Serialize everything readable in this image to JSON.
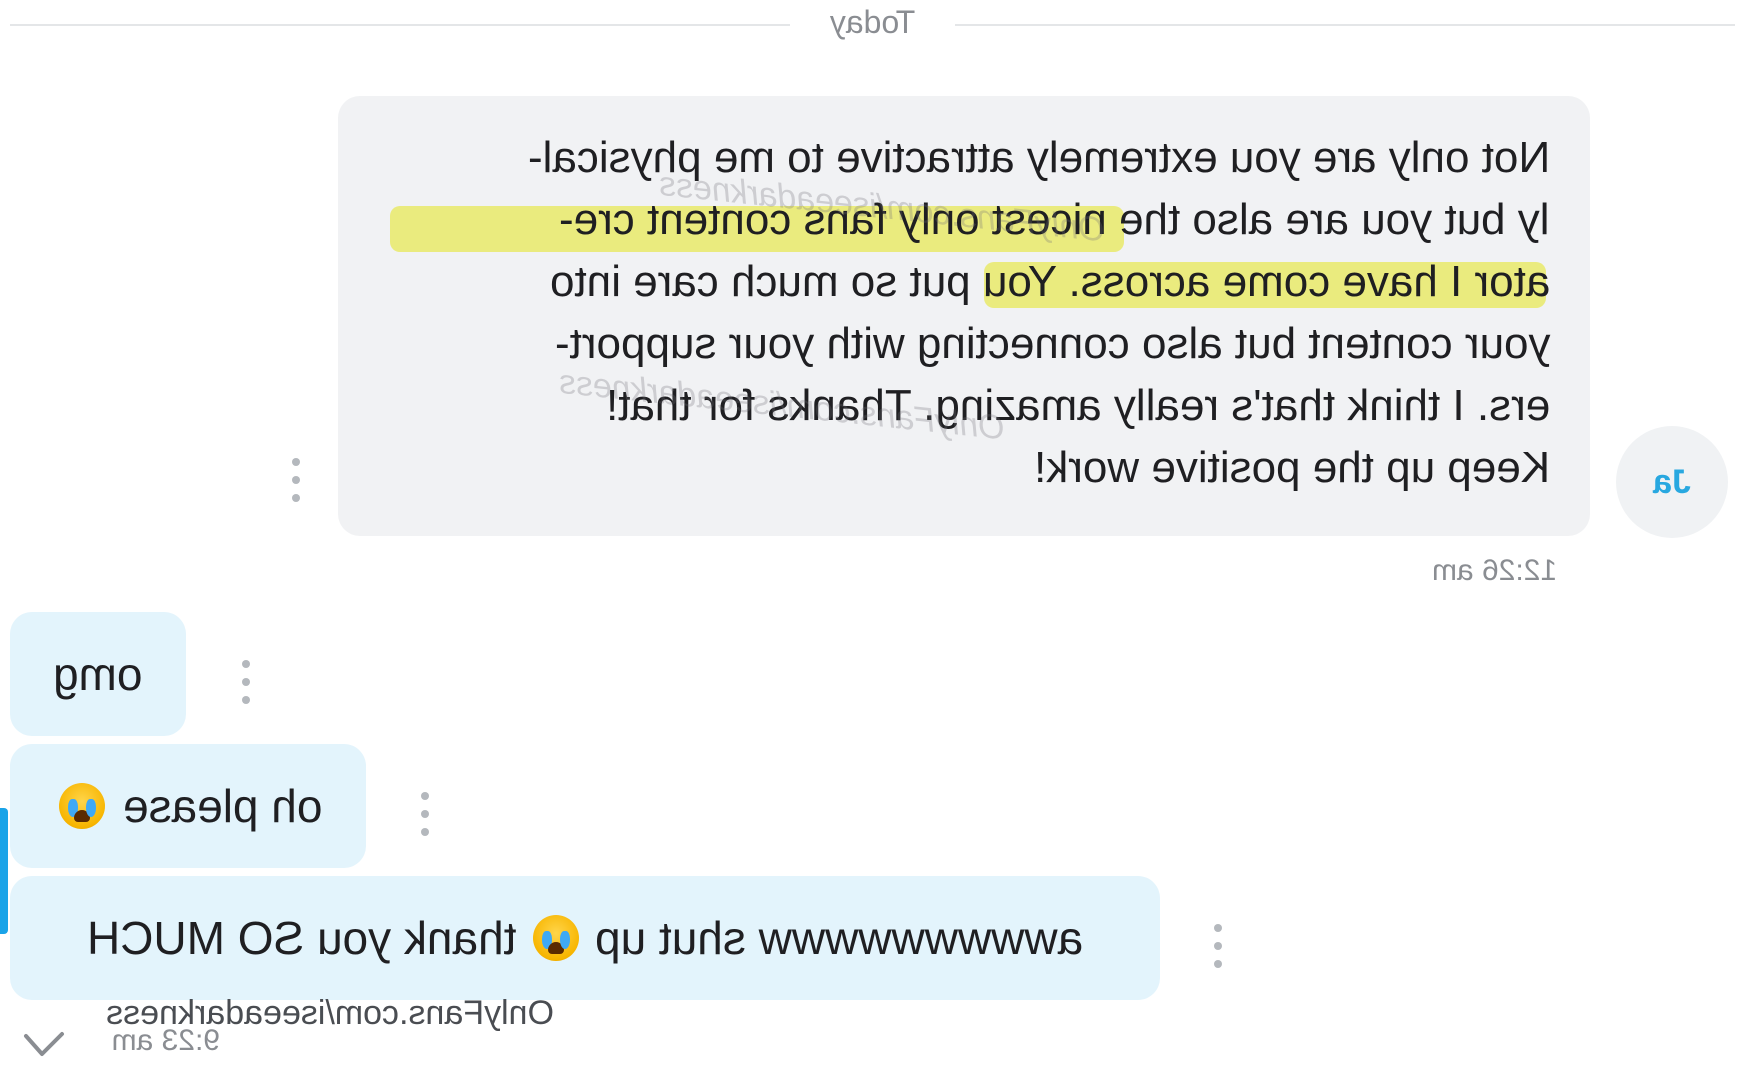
{
  "date_separator": "Today",
  "incoming": {
    "avatar_initials": "Ja",
    "lines": [
      "Not only are you extremely attractive to me physical-",
      "ly but you are also the nicest only fans content cre-",
      "ator I have come across. You put so much care into",
      "your content but also connecting with your support-",
      "ers. I think that's really amazing. Thanks for that!",
      "Keep up the positive work!"
    ],
    "watermark": "OnlyFans.com/iseeadarkness",
    "time": "12:26 am"
  },
  "outgoing": [
    {
      "text": "omg",
      "emoji": ""
    },
    {
      "text": "oh please",
      "emoji": "loudly-crying-face"
    },
    {
      "text_before": "awwwwwwwww shut up",
      "emoji": "loudly-crying-face",
      "text_after": "thank you SO MUCH"
    }
  ],
  "outgoing_time": "9:23 am",
  "footer_watermark": "OnlyFans.com/iseeadarkness",
  "colors": {
    "incoming_bubble": "#f1f2f4",
    "outgoing_bubble": "#e3f4fc",
    "highlight": "#e8e850",
    "accent": "#1aa3e8"
  }
}
